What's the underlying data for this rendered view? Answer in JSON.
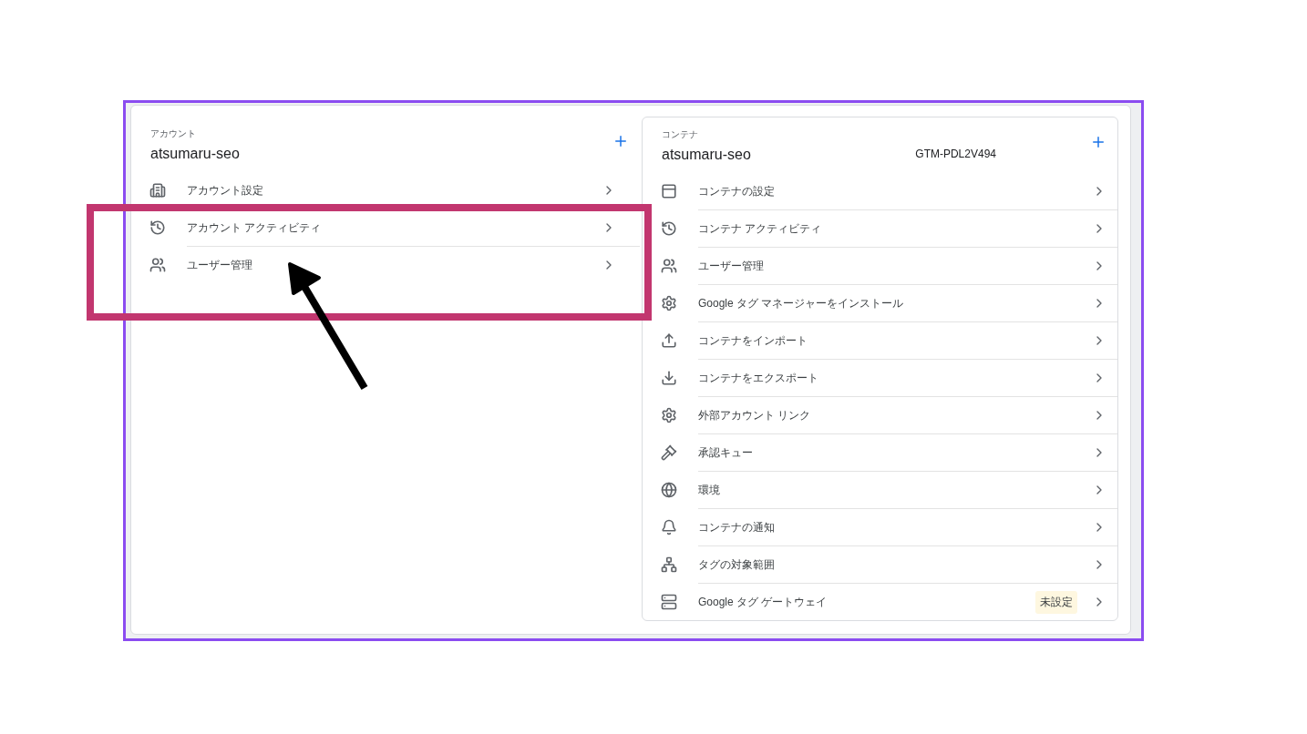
{
  "account": {
    "label": "アカウント",
    "name": "atsumaru-seo",
    "items": [
      {
        "label": "アカウント設定"
      },
      {
        "label": "アカウント アクティビティ"
      },
      {
        "label": "ユーザー管理"
      }
    ]
  },
  "container": {
    "label": "コンテナ",
    "name": "atsumaru-seo",
    "id": "GTM-PDL2V494",
    "items": [
      {
        "label": "コンテナの設定"
      },
      {
        "label": "コンテナ アクティビティ"
      },
      {
        "label": "ユーザー管理"
      },
      {
        "label": "Google タグ マネージャーをインストール"
      },
      {
        "label": "コンテナをインポート"
      },
      {
        "label": "コンテナをエクスポート"
      },
      {
        "label": "外部アカウント リンク"
      },
      {
        "label": "承認キュー"
      },
      {
        "label": "環境"
      },
      {
        "label": "コンテナの通知"
      },
      {
        "label": "タグの対象範囲"
      },
      {
        "label": "Google タグ ゲートウェイ",
        "badge": "未設定"
      }
    ]
  }
}
